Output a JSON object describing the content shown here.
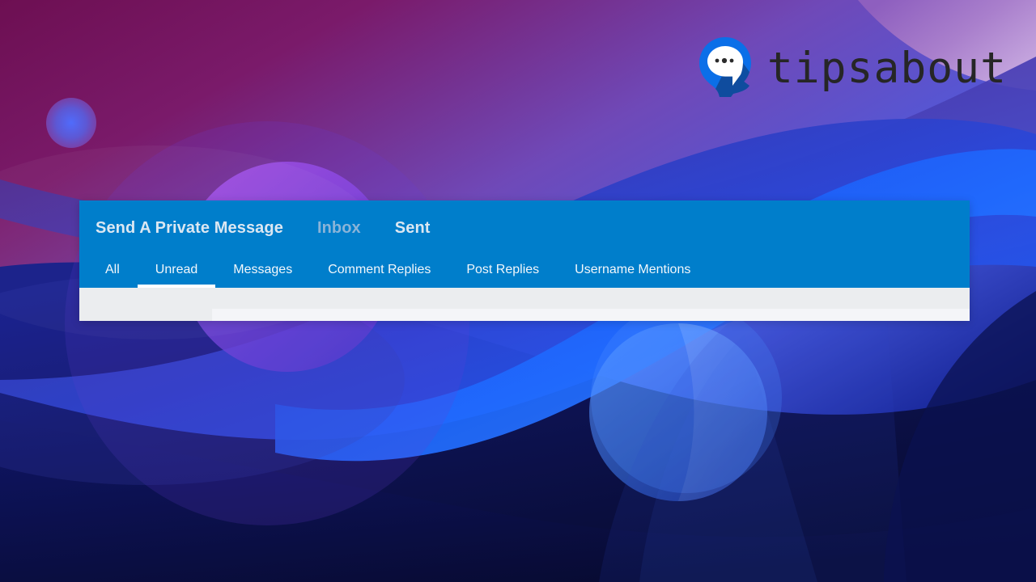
{
  "brand": {
    "wordmark": "tipsabout",
    "logo_icon": "chat-bubble-pin-logo",
    "logo_colors": {
      "pin": "#0b6fe8",
      "shadow": "#0f4c9e",
      "bubble": "#ffffff",
      "dots": "#2b2b2b"
    },
    "wordmark_color": "#262626"
  },
  "panel": {
    "accent_color": "#007ecb",
    "titles": [
      {
        "label": "Send A Private Message",
        "state": "normal"
      },
      {
        "label": "Inbox",
        "state": "muted"
      },
      {
        "label": "Sent",
        "state": "normal"
      }
    ],
    "tabs": [
      {
        "label": "All",
        "active": false
      },
      {
        "label": "Unread",
        "active": true
      },
      {
        "label": "Messages",
        "active": false
      },
      {
        "label": "Comment Replies",
        "active": false
      },
      {
        "label": "Post Replies",
        "active": false
      },
      {
        "label": "Username Mentions",
        "active": false
      }
    ],
    "body": {
      "background_color": "#ebedef",
      "strip_color": "#f4f5f8",
      "content": ""
    }
  },
  "wallpaper": {
    "description": "abstract purple-to-navy gradient with waves and translucent circles",
    "colors": {
      "top_left_magenta": "#6d0f52",
      "mid_purple": "#5a2b94",
      "royal_blue": "#2a4fe0",
      "bright_blue": "#1f6bff",
      "deep_navy": "#090b33",
      "lavender": "#b79ad6",
      "violet_circle": "#a24ee0",
      "sky_circle": "#4f8cff"
    }
  }
}
